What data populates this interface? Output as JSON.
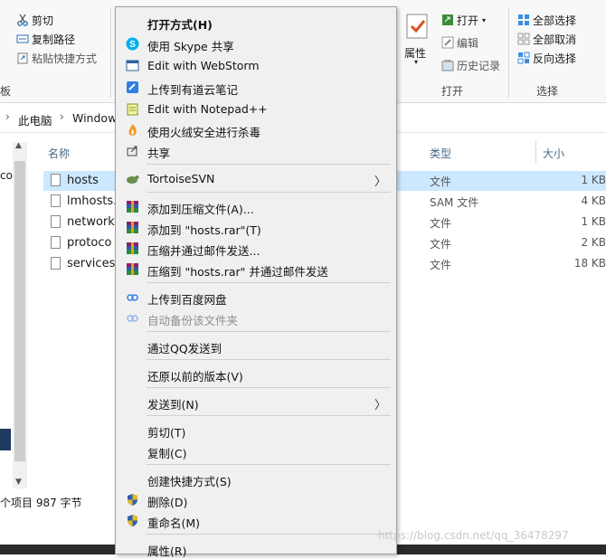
{
  "ribbon": {
    "clipboard_items": [
      "剪切",
      "复制路径",
      "粘贴快捷方式"
    ],
    "clipboard_group": "板",
    "props_label": "属性",
    "open_items": [
      "打开",
      "编辑",
      "历史记录"
    ],
    "open_group": "打开",
    "select_items": [
      "全部选择",
      "全部取消",
      "反向选择"
    ],
    "select_group": "选择"
  },
  "address": {
    "crumb1": "此电脑",
    "crumb2": "Window"
  },
  "columns": {
    "name": "名称",
    "type": "类型",
    "size": "大小"
  },
  "nav_fragment": "co",
  "files": [
    {
      "name": "hosts",
      "type": "文件",
      "size": "1 KB",
      "selected": true
    },
    {
      "name": "lmhosts.",
      "type": "SAM 文件",
      "size": "4 KB",
      "selected": false
    },
    {
      "name": "network",
      "type": "文件",
      "size": "1 KB",
      "selected": false
    },
    {
      "name": "protoco",
      "type": "文件",
      "size": "2 KB",
      "selected": false
    },
    {
      "name": "services",
      "type": "文件",
      "size": "18 KB",
      "selected": false
    }
  ],
  "status": {
    "text": "个项目  987 字节"
  },
  "menu": {
    "open_with": "打开方式(H)",
    "skype": "使用 Skype 共享",
    "webstorm": "Edit with WebStorm",
    "youdao": "上传到有道云笔记",
    "notepad": "Edit with Notepad++",
    "huorong": "使用火绒安全进行杀毒",
    "share": "共享",
    "tortoise": "TortoiseSVN",
    "rar_add": "添加到压缩文件(A)...",
    "rar_add_hosts": "添加到 \"hosts.rar\"(T)",
    "rar_mail": "压缩并通过邮件发送...",
    "rar_mail_hosts": "压缩到 \"hosts.rar\" 并通过邮件发送",
    "baidu_upload": "上传到百度网盘",
    "baidu_backup": "自动备份该文件夹",
    "qq_send": "通过QQ发送到",
    "restore": "还原以前的版本(V)",
    "send_to": "发送到(N)",
    "cut": "剪切(T)",
    "copy": "复制(C)",
    "shortcut": "创建快捷方式(S)",
    "delete": "删除(D)",
    "rename": "重命名(M)",
    "properties": "属性(R)"
  },
  "watermark": "https://blog.csdn.net/qq_36478297"
}
